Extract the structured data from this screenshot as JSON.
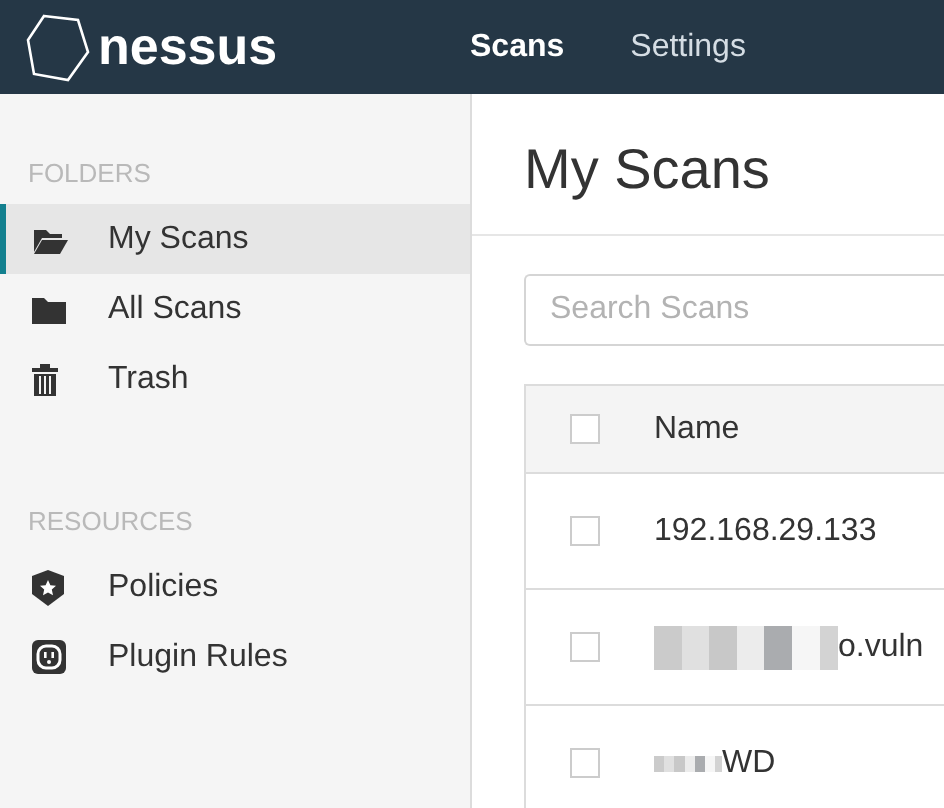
{
  "header": {
    "logo_text": "nessus",
    "nav": [
      {
        "label": "Scans",
        "selected": true
      },
      {
        "label": "Settings",
        "selected": false
      }
    ]
  },
  "sidebar": {
    "sections": [
      {
        "heading": "FOLDERS",
        "items": [
          {
            "label": "My Scans",
            "kind": "openfolder",
            "selected": true
          },
          {
            "label": "All Scans",
            "kind": "folder",
            "selected": false
          },
          {
            "label": "Trash",
            "kind": "trash",
            "selected": false
          }
        ]
      },
      {
        "heading": "RESOURCES",
        "items": [
          {
            "label": "Policies",
            "kind": "policy",
            "selected": false
          },
          {
            "label": "Plugin Rules",
            "kind": "rule",
            "selected": false
          }
        ]
      }
    ]
  },
  "main": {
    "title": "My Scans",
    "search": {
      "placeholder": "Search Scans"
    },
    "table": {
      "columns": [
        "Name"
      ],
      "header_checked": false,
      "rows": [
        {
          "name": "192.168.29.133",
          "redacted": false,
          "checked": false
        },
        {
          "name": "o.vuln",
          "redacted": true,
          "checked": false
        },
        {
          "name": "WD",
          "redacted": true,
          "checked": false
        }
      ]
    }
  }
}
